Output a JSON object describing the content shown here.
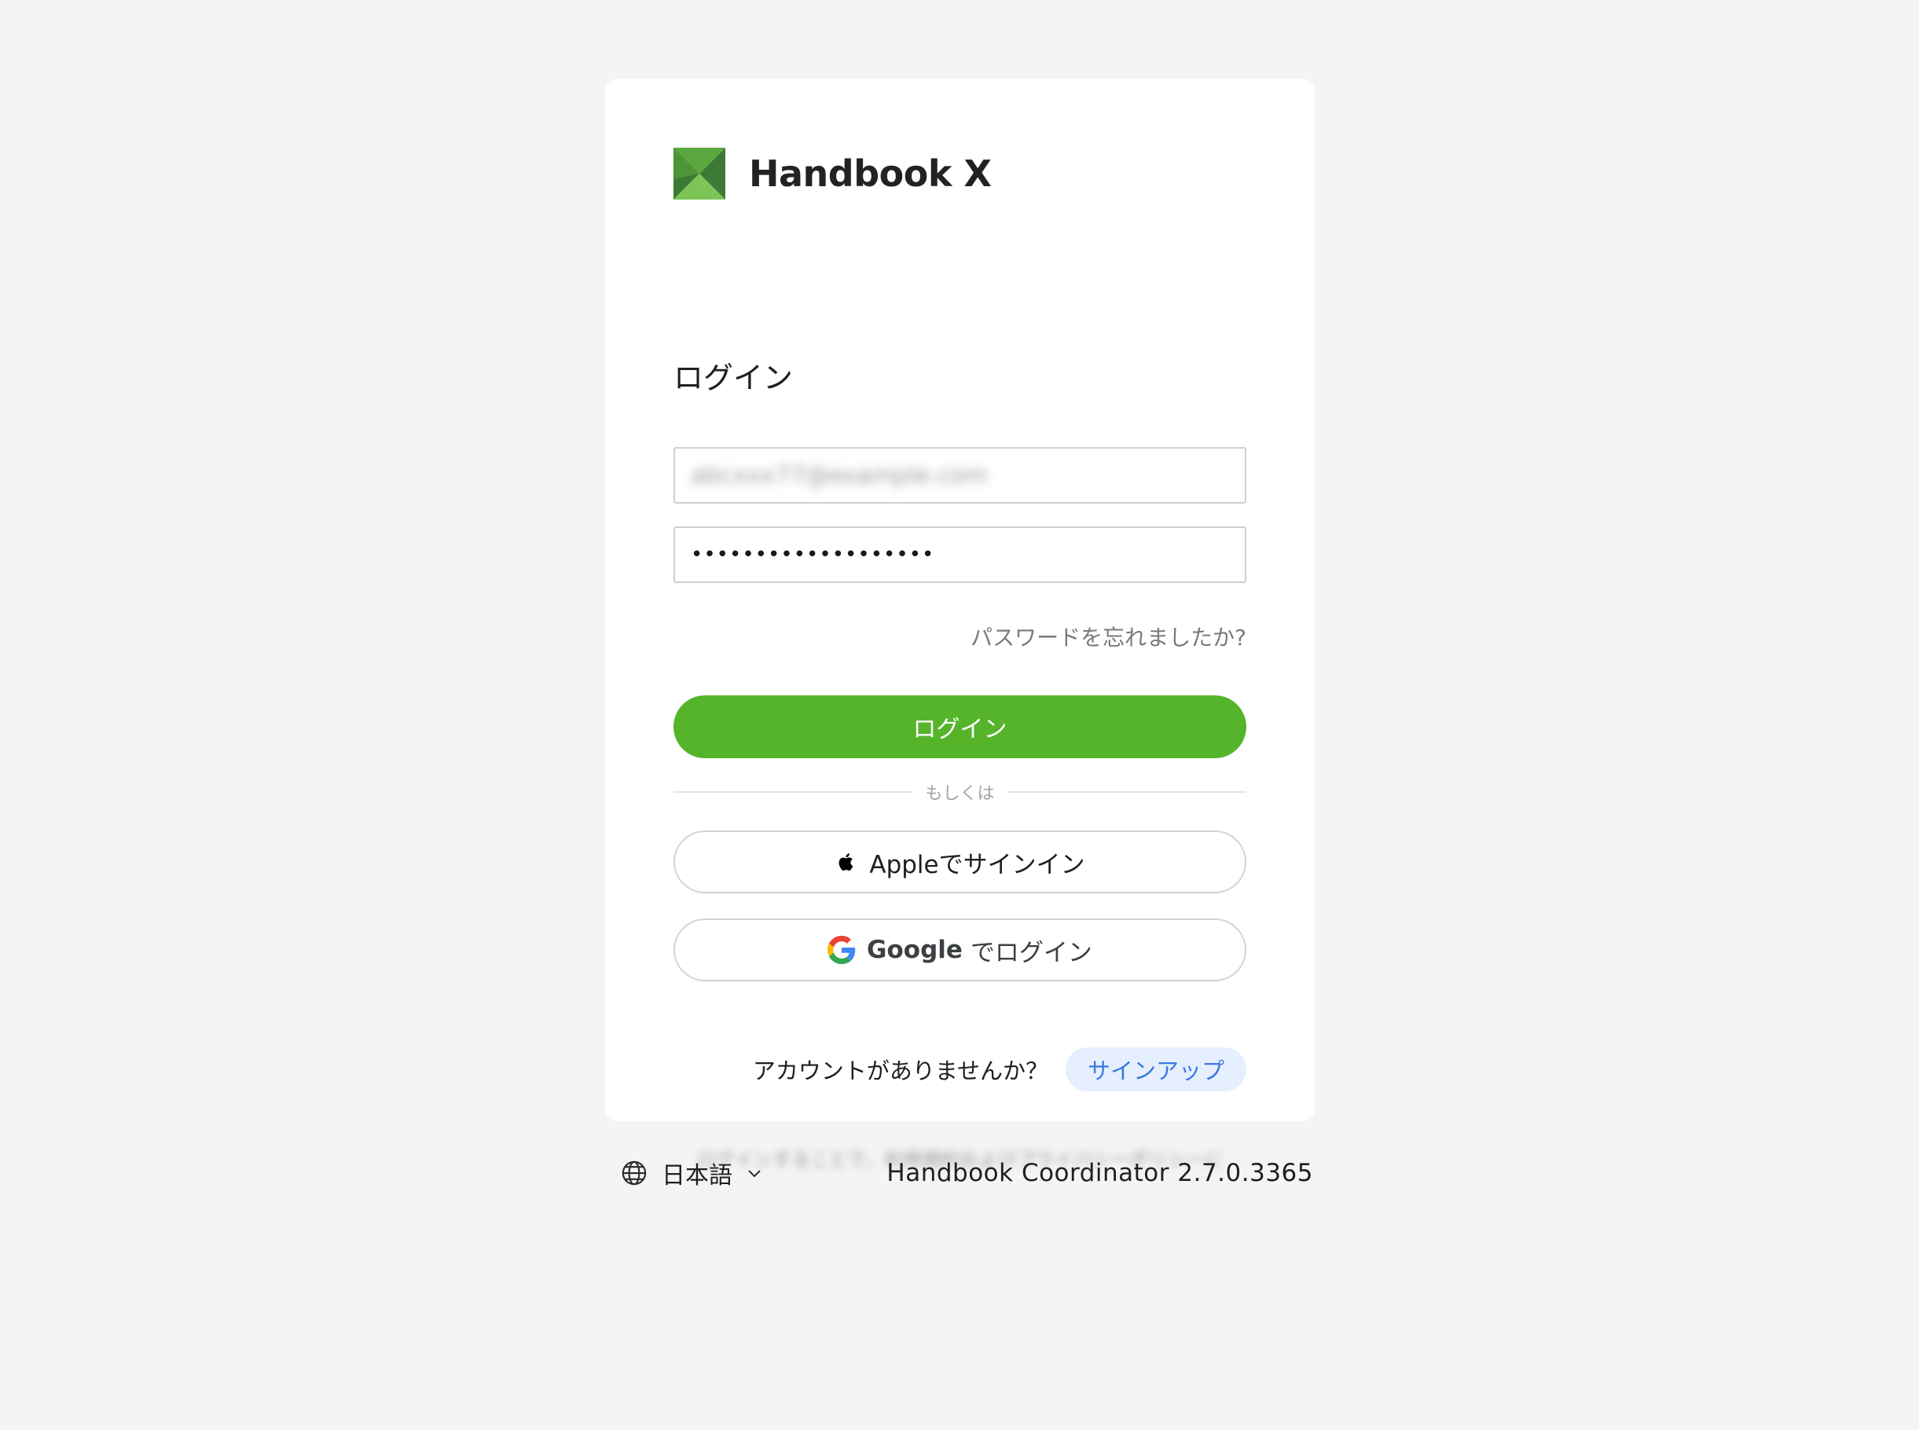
{
  "brand": {
    "name": "Handbook X",
    "logo_icon": "handbook-x-logo-icon",
    "colors": {
      "primary": "#56b42b",
      "logo_dark": "#3d7a35",
      "logo_light": "#6bbf4a"
    }
  },
  "login": {
    "title": "ログイン",
    "email_value": "abcxxx77@example.com",
    "password_value": "•••••••••••••••••••",
    "forgot_label": "パスワードを忘れましたか?",
    "submit_label": "ログイン",
    "divider_label": "もしくは",
    "apple_label": "Appleでサインイン",
    "apple_icon": "apple-icon",
    "google_word": "Google",
    "google_suffix": "でログイン",
    "google_icon": "google-icon",
    "signup_prompt": "アカウントがありませんか？",
    "signup_label": "サインアップ",
    "legal_text": "ログインすることで、利用規約およびプライバシーポリシーに同意したものとみなされます"
  },
  "footer": {
    "language_icon": "globe-icon",
    "language_label": "日本語",
    "language_chevron": "chevron-down-icon",
    "version": "Handbook Coordinator 2.7.0.3365"
  }
}
